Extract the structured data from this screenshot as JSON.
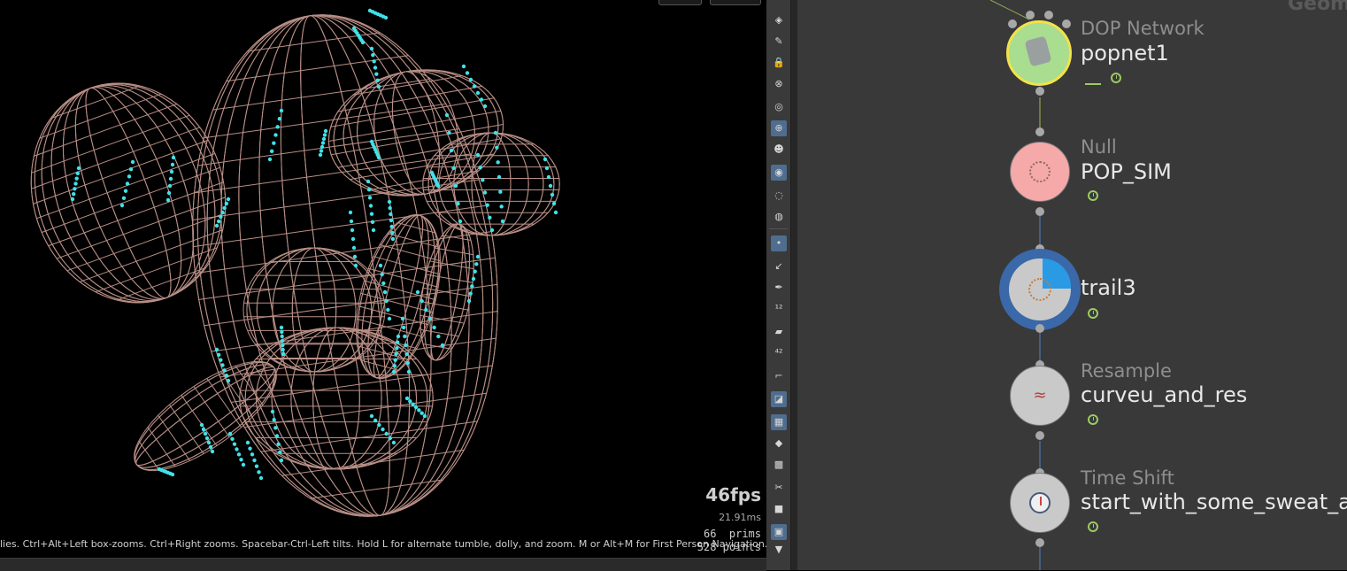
{
  "viewport": {
    "fps": "46fps",
    "frame_time": "21.91ms",
    "prims_line": "66  prims",
    "points_line": "528 points",
    "help_text": "lies. Ctrl+Alt+Left box-zooms. Ctrl+Right zooms. Spacebar-Ctrl-Left tilts. Hold L for alternate tumble, dolly, and zoom. M or Alt+M for First Person Navigation.",
    "wire_color": "#b98f86",
    "point_color": "#3fe2e8"
  },
  "toolbar": {
    "tools": [
      "display-options-icon",
      "select-visible-icon",
      "lock-icon",
      "snapshot-icon",
      "lens-icon",
      "vis-icon",
      "ghost-icon",
      "camera-icon",
      "eye-icon",
      "render-icon",
      "point-display-icon",
      "normals-icon",
      "pen-icon",
      "point-numbers-icon",
      "brush-icon",
      "prim-numbers-icon",
      "corner-icon",
      "shading-icon",
      "checker-icon",
      "shape-icon",
      "tile-icon",
      "scissor-icon",
      "stop-icon",
      "screen-icon",
      "down-arrow-icon"
    ]
  },
  "network": {
    "corner_label": "Geom",
    "nodes": [
      {
        "type": "DOP Network",
        "name": "popnet1",
        "color": "#a9dd90"
      },
      {
        "type": "Null",
        "name": "POP_SIM",
        "color": "#f5a9a9"
      },
      {
        "type": "",
        "name": "trail3",
        "color": "#c9c9c9"
      },
      {
        "type": "Resample",
        "name": "curveu_and_res",
        "color": "#c9c9c9"
      },
      {
        "type": "Time Shift",
        "name": "start_with_some_sweat_a",
        "color": "#c9c9c9"
      }
    ]
  }
}
